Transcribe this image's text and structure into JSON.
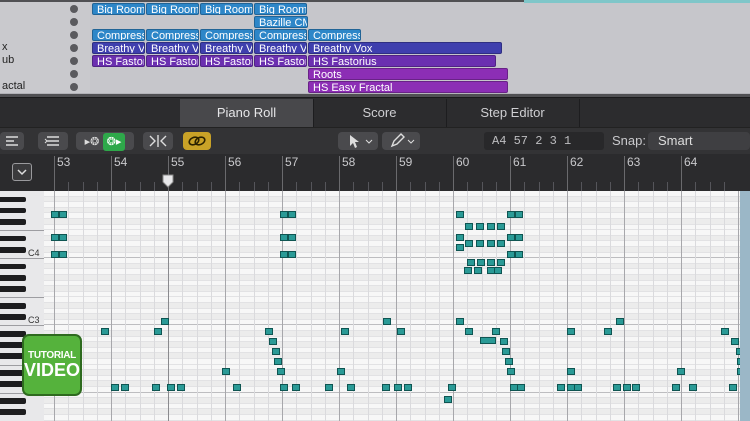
{
  "arrange": {
    "tracks": [
      "",
      "",
      "",
      "x",
      "ub",
      "",
      "actal"
    ],
    "regions": [
      {
        "row": 0,
        "label": "Big Room",
        "color": "blue",
        "start": 0
      },
      {
        "row": 0,
        "label": "Big Room",
        "color": "blue",
        "start": 1
      },
      {
        "row": 0,
        "label": "Big Room",
        "color": "blue",
        "start": 2
      },
      {
        "row": 0,
        "label": "Big Room",
        "color": "blue",
        "start": 3
      },
      {
        "row": 1,
        "label": "Bazille CM",
        "color": "blue",
        "start": 3
      },
      {
        "row": 2,
        "label": "Compress",
        "color": "blue",
        "start": 0
      },
      {
        "row": 2,
        "label": "Compress",
        "color": "blue",
        "start": 1
      },
      {
        "row": 2,
        "label": "Compress",
        "color": "blue",
        "start": 2
      },
      {
        "row": 2,
        "label": "Compress",
        "color": "blue",
        "start": 3
      },
      {
        "row": 2,
        "label": "Compress",
        "color": "blue",
        "start": 4
      },
      {
        "row": 3,
        "label": "Breathy V",
        "color": "indigo",
        "start": 0
      },
      {
        "row": 3,
        "label": "Breathy V",
        "color": "indigo",
        "start": 1
      },
      {
        "row": 3,
        "label": "Breathy V",
        "color": "indigo",
        "start": 2
      },
      {
        "row": 3,
        "label": "Breathy V",
        "color": "indigo",
        "start": 3
      },
      {
        "row": 3,
        "label": "Breathy Vox",
        "color": "indigo",
        "start": 4,
        "long": true
      },
      {
        "row": 4,
        "label": "HS Fastor",
        "color": "purple",
        "start": 0
      },
      {
        "row": 4,
        "label": "HS Fastor",
        "color": "purple",
        "start": 1
      },
      {
        "row": 4,
        "label": "HS Fastor",
        "color": "purple",
        "start": 2
      },
      {
        "row": 4,
        "label": "HS Fastor",
        "color": "purple",
        "start": 3
      },
      {
        "row": 4,
        "label": "HS Fastorius",
        "color": "purple",
        "start": 4,
        "long": true
      },
      {
        "row": 5,
        "label": "Roots",
        "color": "magenta",
        "start": 4,
        "long": true
      },
      {
        "row": 6,
        "label": "HS Easy Fractal",
        "color": "magenta",
        "start": 4,
        "long": true
      }
    ]
  },
  "tabs": [
    {
      "label": "Piano Roll",
      "active": true
    },
    {
      "label": "Score",
      "active": false
    },
    {
      "label": "Step Editor",
      "active": false
    }
  ],
  "toolbar": {
    "position": "A4   57 2 3 1",
    "snap_label": "Snap:",
    "snap_value": "Smart"
  },
  "ruler": {
    "bars": [
      "53",
      "54",
      "55",
      "56",
      "57",
      "58",
      "59",
      "60",
      "61",
      "62",
      "63",
      "64"
    ]
  },
  "keys": {
    "c4_label": "C4",
    "c3_label": "C3"
  },
  "badge": {
    "line1": "TUTORIAL",
    "line2": "VIDEO"
  },
  "colors": {
    "region_blue": "#2d86c8",
    "region_indigo": "#3f3fae",
    "region_purple": "#6b2fb0",
    "note": "#2a9a96",
    "badge": "#55b23c"
  }
}
